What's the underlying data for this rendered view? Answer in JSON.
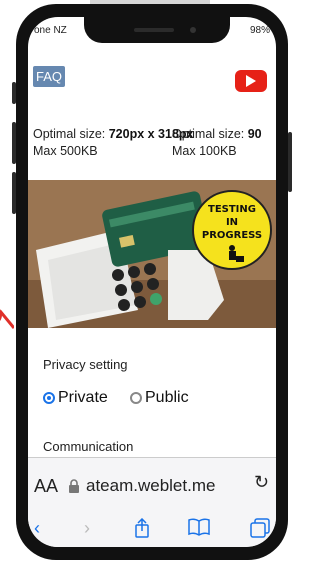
{
  "status_bar": {
    "carrier": "one NZ",
    "battery": "98%"
  },
  "header": {
    "faq_label": "FAQ"
  },
  "upload_info": {
    "left_prefix": "Optimal size: ",
    "left_size": "720px x 318px",
    "left_max": "Max 500KB",
    "right_prefix": "Optimal size: ",
    "right_size": "90",
    "right_max": "Max 100KB"
  },
  "badge": {
    "line1": "TESTING",
    "line2": "IN",
    "line3": "PROGRESS"
  },
  "privacy": {
    "label": "Privacy setting",
    "option_private": "Private",
    "option_public": "Public",
    "selected": "Private"
  },
  "communication": {
    "label": "Communication"
  },
  "browser": {
    "aa_label": "AA",
    "url": "ateam.weblet.me"
  },
  "colors": {
    "accent": "#1a73e8",
    "youtube_red": "#e62117",
    "faq_bg": "#6688b0"
  }
}
